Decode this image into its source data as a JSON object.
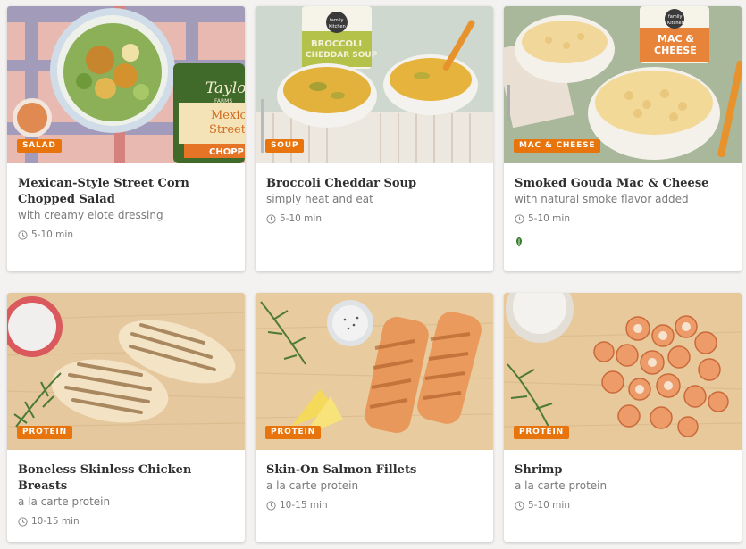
{
  "theme": {
    "badge_color": "#e8740e",
    "leaf_color": "#3a7d2e"
  },
  "cards": [
    {
      "category": "SALAD",
      "title": "Mexican-Style Street Corn Chopped Salad",
      "subtitle": "with creamy elote dressing",
      "time": "5-10 min",
      "image": "salad-bowl-photo",
      "package_text": [
        "Taylor",
        "FARMS",
        "Mexic",
        "Street",
        "CHOPP"
      ]
    },
    {
      "category": "SOUP",
      "title": "Broccoli Cheddar Soup",
      "subtitle": "simply heat and eat",
      "time": "5-10 min",
      "image": "soup-bowls-photo",
      "package_text": [
        "family",
        "Kitchen",
        "BROCCOLI",
        "CHEDDAR SOUP"
      ]
    },
    {
      "category": "MAC & CHEESE",
      "title": "Smoked Gouda Mac & Cheese",
      "subtitle": "with natural smoke flavor added",
      "time": "5-10 min",
      "image": "mac-cheese-photo",
      "icon": "leaf-icon",
      "package_text": [
        "family",
        "Kitchen",
        "MAC &",
        "CHEESE"
      ]
    },
    {
      "category": "PROTEIN",
      "title": "Boneless Skinless Chicken Breasts",
      "subtitle": "a la carte protein",
      "time": "10-15 min",
      "image": "chicken-photo"
    },
    {
      "category": "PROTEIN",
      "title": "Skin-On Salmon Fillets",
      "subtitle": "a la carte protein",
      "time": "10-15 min",
      "image": "salmon-photo"
    },
    {
      "category": "PROTEIN",
      "title": "Shrimp",
      "subtitle": "a la carte protein",
      "time": "5-10 min",
      "image": "shrimp-photo"
    }
  ]
}
